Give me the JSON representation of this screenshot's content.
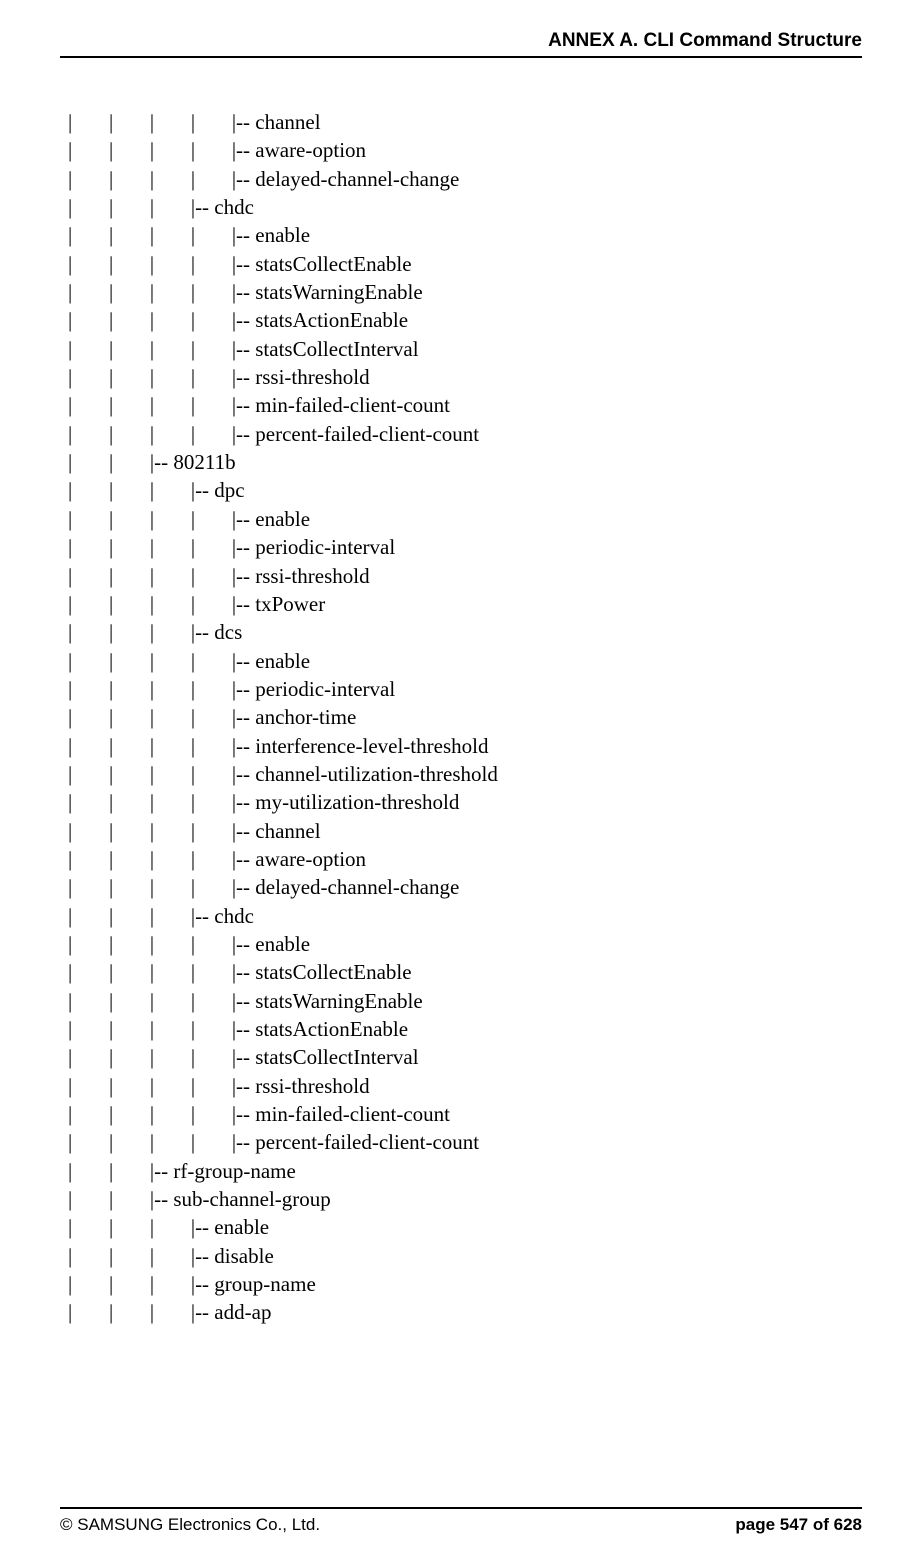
{
  "header": {
    "title": "ANNEX A. CLI Command Structure"
  },
  "tree_lines": [
    "|       |       |       |       |-- channel",
    "|       |       |       |       |-- aware-option",
    "|       |       |       |       |-- delayed-channel-change",
    "|       |       |       |-- chdc",
    "|       |       |       |       |-- enable",
    "|       |       |       |       |-- statsCollectEnable",
    "|       |       |       |       |-- statsWarningEnable",
    "|       |       |       |       |-- statsActionEnable",
    "|       |       |       |       |-- statsCollectInterval",
    "|       |       |       |       |-- rssi-threshold",
    "|       |       |       |       |-- min-failed-client-count",
    "|       |       |       |       |-- percent-failed-client-count",
    "|       |       |-- 80211b",
    "|       |       |       |-- dpc",
    "|       |       |       |       |-- enable",
    "|       |       |       |       |-- periodic-interval",
    "|       |       |       |       |-- rssi-threshold",
    "|       |       |       |       |-- txPower",
    "|       |       |       |-- dcs",
    "|       |       |       |       |-- enable",
    "|       |       |       |       |-- periodic-interval",
    "|       |       |       |       |-- anchor-time",
    "|       |       |       |       |-- interference-level-threshold",
    "|       |       |       |       |-- channel-utilization-threshold",
    "|       |       |       |       |-- my-utilization-threshold",
    "|       |       |       |       |-- channel",
    "|       |       |       |       |-- aware-option",
    "|       |       |       |       |-- delayed-channel-change",
    "|       |       |       |-- chdc",
    "|       |       |       |       |-- enable",
    "|       |       |       |       |-- statsCollectEnable",
    "|       |       |       |       |-- statsWarningEnable",
    "|       |       |       |       |-- statsActionEnable",
    "|       |       |       |       |-- statsCollectInterval",
    "|       |       |       |       |-- rssi-threshold",
    "|       |       |       |       |-- min-failed-client-count",
    "|       |       |       |       |-- percent-failed-client-count",
    "|       |       |-- rf-group-name",
    "|       |       |-- sub-channel-group",
    "|       |       |       |-- enable",
    "|       |       |       |-- disable",
    "|       |       |       |-- group-name",
    "|       |       |       |-- add-ap"
  ],
  "footer": {
    "copyright": "© SAMSUNG Electronics Co., Ltd.",
    "page": "page 547 of 628"
  }
}
